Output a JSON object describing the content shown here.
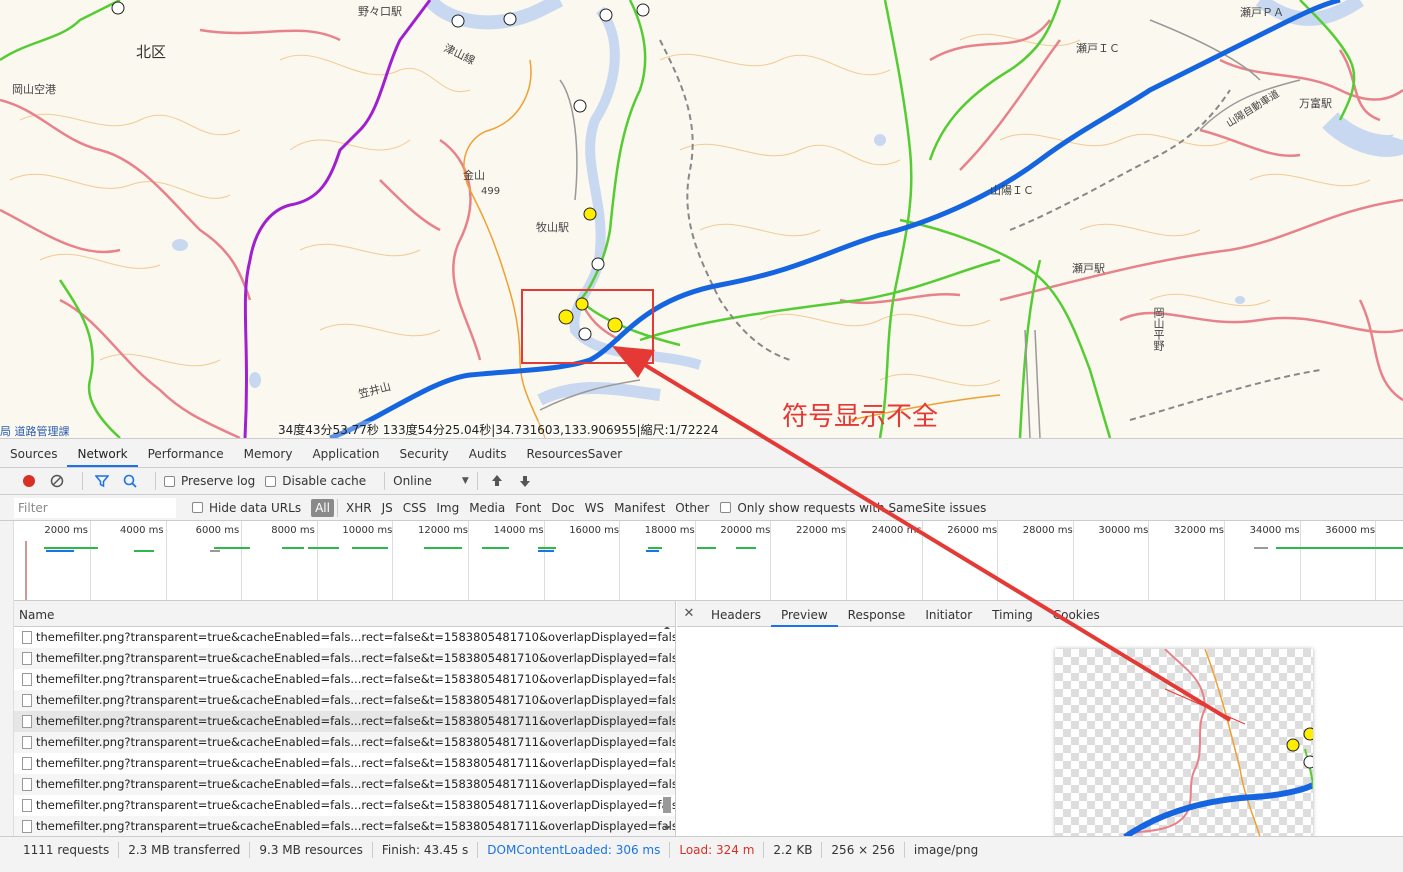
{
  "map": {
    "labels": {
      "kita_ku": "北区",
      "nonokuchi_station": "野々口駅",
      "tsuyama_line": "津山線",
      "okayama_airport": "岡山空港",
      "kanayama": "金山",
      "kanayama_elev": "499",
      "makiyama_station": "牧山駅",
      "seto_ic": "瀬戸ＩＣ",
      "seto_pa": "瀬戸ＰＡ",
      "sanyo_ic": "山陽ＩＣ",
      "seto_station": "瀬戸駅",
      "manTomi_station": "万富駅",
      "okayama_heiya": "岡山平野",
      "sanyo_expressway": "山陽自動車道",
      "kasaiyama": "笠井山"
    },
    "attribution": "局 道路管理課",
    "coordinates": "34度43分53.77秒 133度54分25.04秒|34.731603,133.906955|縮尺:1/72224",
    "annotation": "符号显示不全"
  },
  "colors": {
    "highway": "#1565e0",
    "railway_green": "#55cc33",
    "road_pink": "#e8828a",
    "purple_route": "#a020d0",
    "contour": "#f2c68a",
    "river": "#c8d8f0",
    "annotation_red": "#e53935"
  },
  "devtools": {
    "tabs": [
      "Sources",
      "Network",
      "Performance",
      "Memory",
      "Application",
      "Security",
      "Audits",
      "ResourcesSaver"
    ],
    "active_tab": "Network",
    "toolbar": {
      "preserve_log": "Preserve log",
      "disable_cache": "Disable cache",
      "throttle": "Online"
    },
    "filter": {
      "placeholder": "Filter",
      "hide_data_urls": "Hide data URLs",
      "types": [
        "All",
        "XHR",
        "JS",
        "CSS",
        "Img",
        "Media",
        "Font",
        "Doc",
        "WS",
        "Manifest",
        "Other"
      ],
      "samesite": "Only show requests with SameSite issues"
    },
    "overview_ticks": [
      "2000 ms",
      "4000 ms",
      "6000 ms",
      "8000 ms",
      "10000 ms",
      "12000 ms",
      "14000 ms",
      "16000 ms",
      "18000 ms",
      "20000 ms",
      "22000 ms",
      "24000 ms",
      "26000 ms",
      "28000 ms",
      "30000 ms",
      "32000 ms",
      "34000 ms",
      "36000 ms"
    ],
    "name_header": "Name",
    "requests": [
      "themefilter.png?transparent=true&cacheEnabled=fals...rect=false&t=1583805481710&overlapDisplayed=false",
      "themefilter.png?transparent=true&cacheEnabled=fals...rect=false&t=1583805481710&overlapDisplayed=false",
      "themefilter.png?transparent=true&cacheEnabled=fals...rect=false&t=1583805481710&overlapDisplayed=false",
      "themefilter.png?transparent=true&cacheEnabled=fals...rect=false&t=1583805481710&overlapDisplayed=false",
      "themefilter.png?transparent=true&cacheEnabled=fals...rect=false&t=1583805481711&overlapDisplayed=false",
      "themefilter.png?transparent=true&cacheEnabled=fals...rect=false&t=1583805481711&overlapDisplayed=false",
      "themefilter.png?transparent=true&cacheEnabled=fals...rect=false&t=1583805481711&overlapDisplayed=false",
      "themefilter.png?transparent=true&cacheEnabled=fals...rect=false&t=1583805481711&overlapDisplayed=false",
      "themefilter.png?transparent=true&cacheEnabled=fals...rect=false&t=1583805481711&overlapDisplayed=false",
      "themefilter.png?transparent=true&cacheEnabled=fals...rect=false&t=1583805481711&overlapDisplayed=false"
    ],
    "detail_tabs": [
      "Headers",
      "Preview",
      "Response",
      "Initiator",
      "Timing",
      "Cookies"
    ],
    "active_detail_tab": "Preview",
    "status": {
      "requests": "1111 requests",
      "transferred": "2.3 MB transferred",
      "resources": "9.3 MB resources",
      "finish": "Finish: 43.45 s",
      "dom_loaded": "DOMContentLoaded: 306 ms",
      "load": "Load: 324 m",
      "size": "2.2 KB",
      "dims": "256 × 256",
      "mime": "image/png"
    }
  }
}
